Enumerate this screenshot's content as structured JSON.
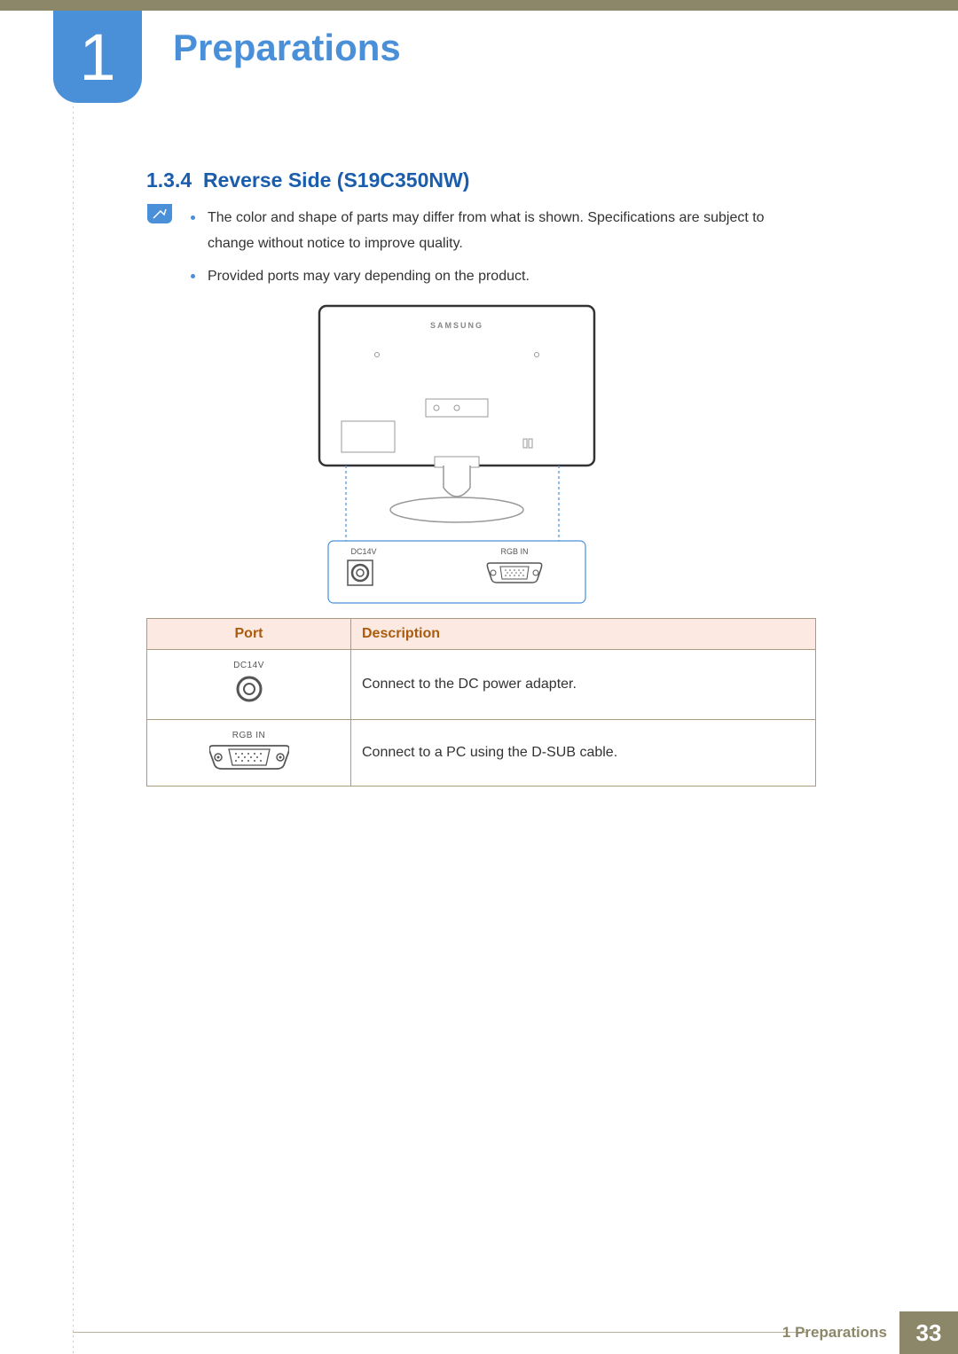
{
  "chapter": {
    "number": "1",
    "title": "Preparations"
  },
  "section": {
    "number": "1.3.4",
    "title": "Reverse Side (S19C350NW)"
  },
  "notes": [
    "The color and shape of parts may differ from what is shown. Specifications are subject to change without notice to improve quality.",
    "Provided ports may vary depending on the product."
  ],
  "diagram": {
    "brand_label": "SAMSUNG",
    "callout_labels": {
      "left": "DC14V",
      "right": "RGB IN"
    }
  },
  "table": {
    "headers": {
      "port": "Port",
      "description": "Description"
    },
    "rows": [
      {
        "port_label": "DC14V",
        "port_type": "dc",
        "description": "Connect to the DC power adapter."
      },
      {
        "port_label": "RGB IN",
        "port_type": "dsub",
        "description": "Connect to a PC using the D-SUB cable."
      }
    ]
  },
  "footer": {
    "chapter_ref": "1 Preparations",
    "page_number": "33"
  }
}
